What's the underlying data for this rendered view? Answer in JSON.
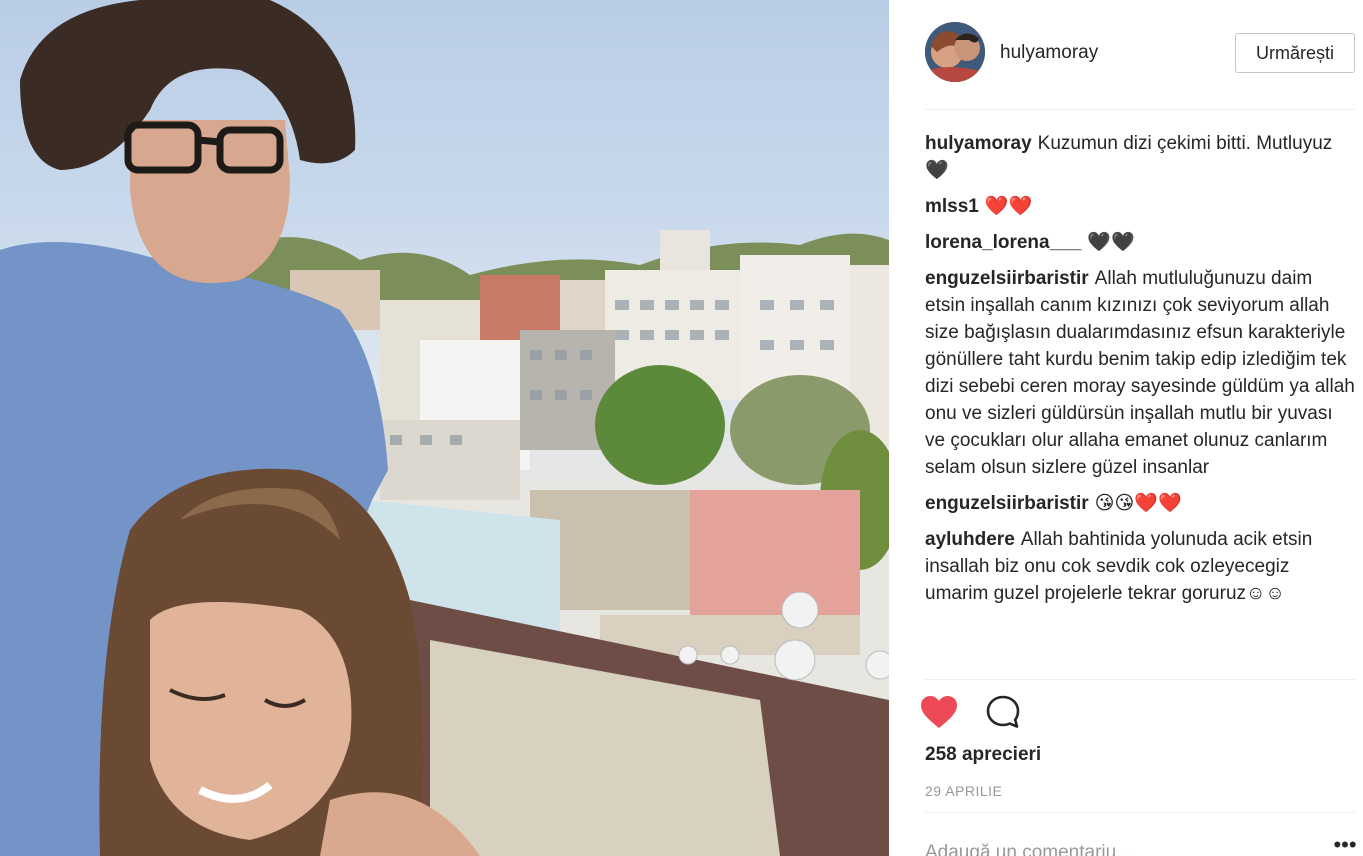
{
  "post": {
    "username": "hulyamoray",
    "follow_label": "Urmărești",
    "comments": [
      {
        "author": "hulyamoray",
        "text": "Kuzumun dizi çekimi bitti. Mutluyuz🖤"
      },
      {
        "author": "mlss1",
        "text": "❤️❤️"
      },
      {
        "author": "lorena_lorena___",
        "text": "🖤🖤"
      },
      {
        "author": "enguzelsiirbaristir",
        "text": "Allah mutluluğunuzu daim etsin inşallah canım kızınızı çok seviyorum allah size bağışlasın dualarımdasınız efsun karakteriyle gönüllere taht kurdu benim takip edip izlediğim tek dizi sebebi ceren moray sayesinde güldüm ya allah onu ve sizleri güldürsün inşallah mutlu bir yuvası ve çocukları olur allaha emanet olunuz canlarım selam olsun sizlere güzel insanlar"
      },
      {
        "author": "enguzelsiirbaristir",
        "text": "😘😘❤️❤️"
      },
      {
        "author": "ayluhdere",
        "text": "Allah bahtinida yolunuda acik etsin insallah biz onu cok sevdik cok ozleyecegiz umarim guzel projelerle tekrar goruruz☺☺"
      }
    ],
    "likes": "258 aprecieri",
    "date": "29 APRILIE",
    "comment_placeholder": "Adaugă un comentariu...",
    "more_label": "•••",
    "like_icon": "heart-filled-icon",
    "comment_icon": "speech-bubble-icon",
    "colors": {
      "like": "#ed4956",
      "text": "#262626",
      "muted": "#999999",
      "divider": "#efefef"
    }
  }
}
